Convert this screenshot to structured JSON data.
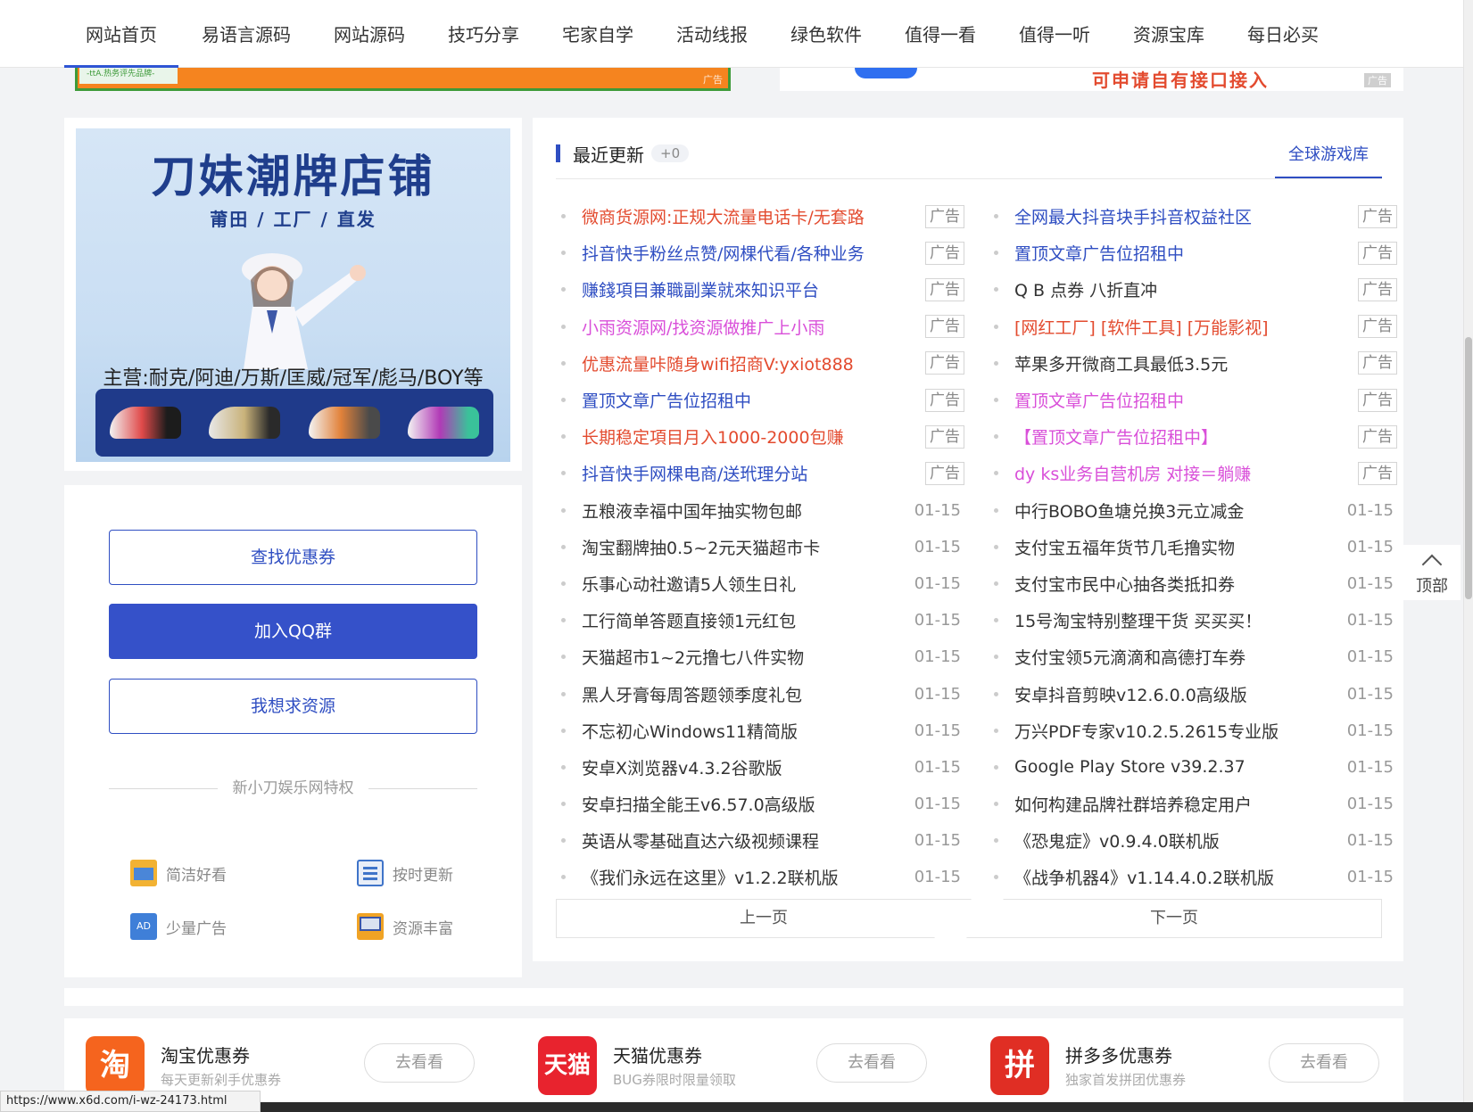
{
  "nav": {
    "items": [
      "网站首页",
      "易语言源码",
      "网站源码",
      "技巧分享",
      "宅家自学",
      "活动线报",
      "绿色软件",
      "值得一看",
      "值得一听",
      "资源宝库",
      "每日必买"
    ]
  },
  "top_ad": {
    "left_inner": "-ttA.热务评先品牌-",
    "left_tag": "广告",
    "right_text": "可申请自有接口接入",
    "right_tag": "广告"
  },
  "banner": {
    "title": "刀妹潮牌店铺",
    "subtitle": "莆田 / 工厂 / 直发",
    "main": "主营:耐克/阿迪/万斯/匡威/冠军/彪马/BOY等"
  },
  "left_card": {
    "btn1": "查找优惠券",
    "btn2": "加入QQ群",
    "btn3": "我想求资源",
    "divider": "新小刀娱乐网特权",
    "features": [
      "简洁好看",
      "按时更新",
      "少量广告",
      "资源丰富"
    ]
  },
  "recent": {
    "title": "最近更新",
    "count": "+0",
    "link": "全球游戏库",
    "tag_label": "广告",
    "col1": [
      {
        "text": "微商货源网:正规大流量电话卡/无套路",
        "color": "#e34b2f",
        "tag": "广告"
      },
      {
        "text": "抖音快手粉丝点赞/网棵代看/各种业务",
        "color": "#2f4ec2",
        "tag": "广告"
      },
      {
        "text": "赚錢項目兼職副業就來知识平台",
        "color": "#2f4ec2",
        "tag": "广告"
      },
      {
        "text": "小雨资源网/找资源做推广上小雨",
        "color": "#d94fd9",
        "tag": "广告"
      },
      {
        "text": "优惠流量咔随身wifi招商V:yxiot888",
        "color": "#e34b2f",
        "tag": "广告"
      },
      {
        "text": "置顶文章广告位招租中",
        "color": "#2f4ec2",
        "tag": "广告"
      },
      {
        "text": "长期稳定項目月入1000-2000包赚",
        "color": "#e34b2f",
        "tag": "广告"
      },
      {
        "text": "抖音快手网棵电商/送玳理分站",
        "color": "#2f4ec2",
        "tag": "广告"
      },
      {
        "text": "五粮液幸福中国年抽实物包邮",
        "color": "#333",
        "date": "01-15"
      },
      {
        "text": "淘宝翻牌抽0.5~2元天猫超市卡",
        "color": "#333",
        "date": "01-15"
      },
      {
        "text": "乐事心动社邀请5人领生日礼",
        "color": "#333",
        "date": "01-15"
      },
      {
        "text": "工行简单答题直接领1元红包",
        "color": "#333",
        "date": "01-15"
      },
      {
        "text": "天猫超市1~2元撸七八件实物",
        "color": "#333",
        "date": "01-15"
      },
      {
        "text": "黑人牙膏每周答题领季度礼包",
        "color": "#333",
        "date": "01-15"
      },
      {
        "text": "不忘初心Windows11精简版",
        "color": "#333",
        "date": "01-15"
      },
      {
        "text": "安卓X浏览器v4.3.2谷歌版",
        "color": "#333",
        "date": "01-15"
      },
      {
        "text": "安卓扫描全能王v6.57.0高级版",
        "color": "#333",
        "date": "01-15"
      },
      {
        "text": "英语从零基础直达六级视频课程",
        "color": "#333",
        "date": "01-15"
      },
      {
        "text": "《我们永远在这里》v1.2.2联机版",
        "color": "#333",
        "date": "01-15"
      }
    ],
    "col2": [
      {
        "text": "全网最大抖音块手抖音权益社区",
        "color": "#2f4ec2",
        "tag": "广告"
      },
      {
        "text": "置顶文章广告位招租中",
        "color": "#2f4ec2",
        "tag": "广告"
      },
      {
        "text": "Q B 点券 八折直冲",
        "color": "#333",
        "tag": "广告"
      },
      {
        "text": "[网红工厂] [软件工具] [万能影视]",
        "color": "#e34b2f",
        "tag": "广告"
      },
      {
        "text": "苹果多开微商工具最低3.5元",
        "color": "#333",
        "tag": "广告"
      },
      {
        "text": "置顶文章广告位招租中",
        "color": "#d94fd9",
        "tag": "广告"
      },
      {
        "text": "【置顶文章广告位招租中】",
        "color": "#d94fd9",
        "tag": "广告"
      },
      {
        "text": "dy ks业务自营机房 对接＝躺赚",
        "color": "#d94fd9",
        "tag": "广告"
      },
      {
        "text": "中行BOBO鱼塘兑换3元立减金",
        "color": "#333",
        "date": "01-15"
      },
      {
        "text": "支付宝五福年货节几毛撸实物",
        "color": "#333",
        "date": "01-15"
      },
      {
        "text": "支付宝市民中心抽各类抵扣券",
        "color": "#333",
        "date": "01-15"
      },
      {
        "text": "15号淘宝特别整理干货 买买买！",
        "color": "#333",
        "date": "01-15"
      },
      {
        "text": "支付宝领5元滴滴和高德打车券",
        "color": "#333",
        "date": "01-15"
      },
      {
        "text": "安卓抖音剪映v12.6.0.0高级版",
        "color": "#333",
        "date": "01-15"
      },
      {
        "text": "万兴PDF专家v10.2.5.2615专业版",
        "color": "#333",
        "date": "01-15"
      },
      {
        "text": "Google Play Store v39.2.37",
        "color": "#333",
        "date": "01-15"
      },
      {
        "text": "如何构建品牌社群培养稳定用户",
        "color": "#333",
        "date": "01-15"
      },
      {
        "text": "《恐鬼症》v0.9.4.0联机版",
        "color": "#333",
        "date": "01-15"
      },
      {
        "text": "《战争机器4》v1.14.4.0.2联机版",
        "color": "#333",
        "date": "01-15"
      }
    ],
    "prev": "上一页",
    "next": "下一页"
  },
  "totop": "顶部",
  "coupons": [
    {
      "logo": "淘",
      "name": "淘宝优惠券",
      "desc": "每天更新剁手优惠券",
      "go": "去看看",
      "color": "#f5641e"
    },
    {
      "logo": "天猫",
      "name": "天猫优惠券",
      "desc": "BUG券限时限量领取",
      "go": "去看看",
      "color": "#e8232e"
    },
    {
      "logo": "拼",
      "name": "拼多多优惠券",
      "desc": "独家首发拼团优惠券",
      "go": "去看看",
      "color": "#e02e24"
    }
  ],
  "status_url": "https://www.x6d.com/i-wz-24173.html"
}
